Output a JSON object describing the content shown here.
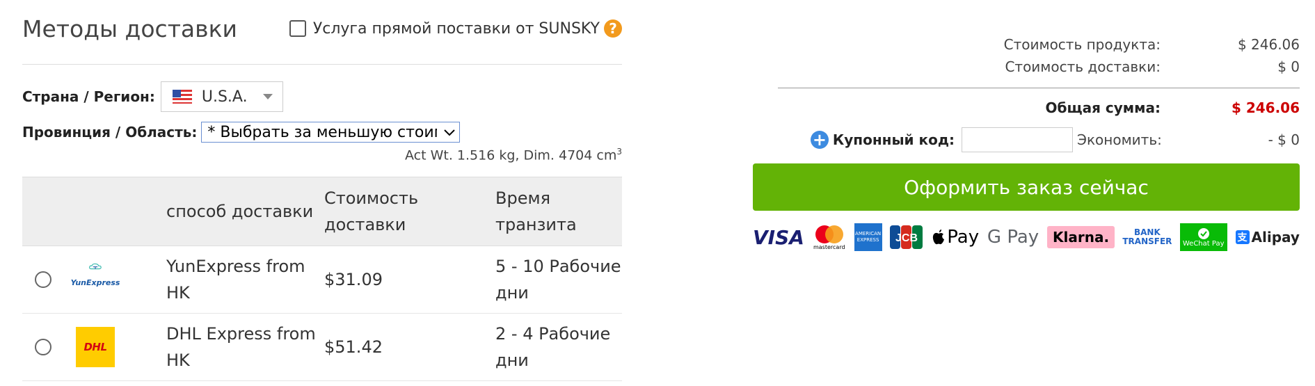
{
  "shipping": {
    "title": "Методы доставки",
    "direct_label": "Услуга прямой поставки от SUNSKY",
    "help_mark": "?",
    "country_label": "Страна / Регион:",
    "country_value": "U.S.A.",
    "province_label": "Провинция / Область:",
    "province_value": "* Выбрать за меньшую стоимость",
    "weight_text": "Act Wt. 1.516 kg, Dim. 4704 cm",
    "weight_sup": "3",
    "table": {
      "headers": [
        "",
        "способ доставки",
        "Стоимость доставки",
        "Время транзита"
      ],
      "rows": [
        {
          "logo": "YunExpress",
          "method": "YunExpress from HK",
          "cost": "$31.09",
          "time": "5 - 10 Рабочие дни"
        },
        {
          "logo": "DHL",
          "method": "DHL Express from HK",
          "cost": "$51.42",
          "time": "2 - 4 Рабочие дни"
        }
      ]
    }
  },
  "summary": {
    "product_label": "Стоимость продукта:",
    "product_value": "$ 246.06",
    "shipping_label": "Стоимость доставки:",
    "shipping_value": "$ 0",
    "total_label": "Общая сумма:",
    "total_value": "$ 246.06",
    "coupon_label": "Купонный код:",
    "save_label": "Экономить:",
    "save_value": "- $ 0",
    "order_button": "Оформить заказ сейчас"
  },
  "payments": [
    "VISA",
    "mastercard",
    "AMERICAN EXPRESS",
    "JCB",
    "Pay",
    "G Pay",
    "Klarna.",
    "BANK TRANSFER",
    "WeChat Pay",
    "Alipay"
  ],
  "colors": {
    "accent_green": "#63b306",
    "total_red": "#cc0000",
    "help_orange": "#f29a1d",
    "dhl_yellow": "#ffcc00"
  }
}
